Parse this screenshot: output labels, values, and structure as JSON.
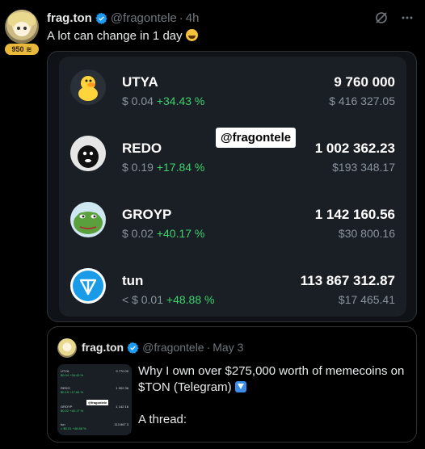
{
  "post": {
    "author_name": "frag.ton",
    "handle": "@fragontele",
    "dot": "·",
    "time": "4h",
    "xp_badge": "950",
    "text": "A lot can change in 1 day",
    "emoji": "grinning-sweat-emoji"
  },
  "top_icons": [
    "grok-icon",
    "more-icon"
  ],
  "card": {
    "watermark": "@fragontele",
    "tokens": [
      {
        "name": "UTYA",
        "price": "$ 0.04",
        "change": "+34.43 %",
        "amount": "9 760 000",
        "value": "$ 416 327.05",
        "icon": "duck-icon"
      },
      {
        "name": "REDO",
        "price": "$ 0.19",
        "change": "+17.84 %",
        "amount": "1 002 362.23",
        "value": "$193 348.17",
        "icon": "redo-icon"
      },
      {
        "name": "GROYP",
        "price": "$ 0.02",
        "change": "+40.17 %",
        "amount": "1 142 160.56",
        "value": "$30 800.16",
        "icon": "frog-icon"
      },
      {
        "name": "tun",
        "price": "< $ 0.01",
        "change": "+48.88 %",
        "amount": "113 867 312.87",
        "value": "$17 465.41",
        "icon": "ton-icon"
      }
    ]
  },
  "quote": {
    "author_name": "frag.ton",
    "handle": "@fragontele",
    "dot": "·",
    "time": "May 3",
    "line1": "Why I own over $275,000 worth of memecoins on",
    "line2": "$TON (Telegram)",
    "line3": "A thread:",
    "thumb": {
      "rows": [
        {
          "name": "UTYA",
          "amount": "9 770 00",
          "sub": "$0.04 +34.43 %"
        },
        {
          "name": "REDO",
          "amount": "1 002 36",
          "sub": "$0.19 +17.84 %"
        },
        {
          "name": "GROYP",
          "amount": "1 142 16",
          "sub": "$0.02 +40.17 %"
        },
        {
          "name": "tun",
          "amount": "113 867 3",
          "sub": "< $0.01 +48.88 %"
        }
      ],
      "watermark": "@fragontele"
    }
  },
  "colors": {
    "background": "#000000",
    "card_bg": "#1a1f26",
    "positive": "#3bd36b",
    "muted": "#71767b",
    "verified": "#1d9bf0",
    "badge": "#e8b93b"
  }
}
